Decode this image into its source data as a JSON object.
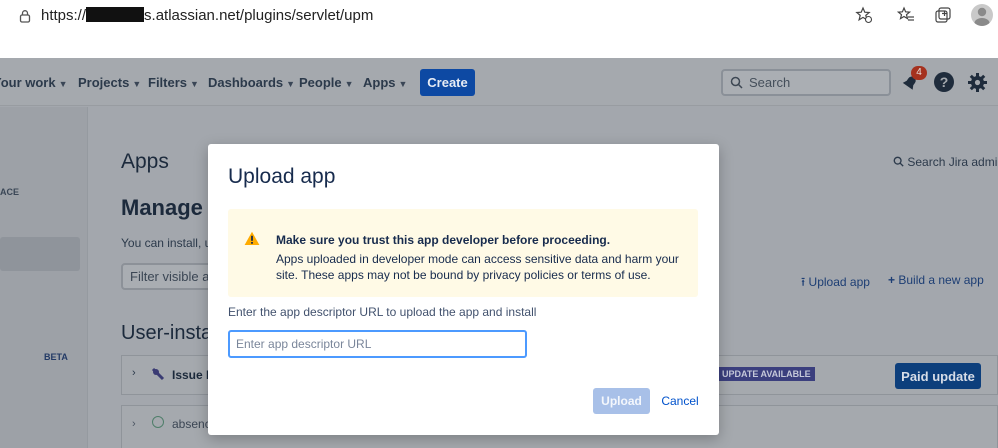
{
  "browser": {
    "url_prefix": "https://",
    "url_suffix": "s.atlassian.net/plugins/servlet/upm"
  },
  "nav": {
    "items": [
      {
        "label": "Your work"
      },
      {
        "label": "Projects"
      },
      {
        "label": "Filters"
      },
      {
        "label": "Dashboards"
      },
      {
        "label": "People"
      },
      {
        "label": "Apps"
      }
    ],
    "create_label": "Create",
    "search_placeholder": "Search",
    "notification_count": "4",
    "help_glyph": "?"
  },
  "sidebar": {
    "section_label": "ACE",
    "beta_label": "BETA"
  },
  "content": {
    "title": "Apps",
    "heading": "Manage a",
    "description": "You can install, u",
    "filter_placeholder": "Filter visible a",
    "user_installed": "User-instal",
    "search_jira_admin": "Search Jira admin",
    "upload_app_link": "Upload app",
    "build_app_link": "Build a new app",
    "rows": [
      {
        "name": "Issue L",
        "lozenge": "UPDATE AVAILABLE",
        "action": "Paid update"
      },
      {
        "name": "absenc"
      }
    ]
  },
  "modal": {
    "title": "Upload app",
    "warning_title": "Make sure you trust this app developer before proceeding.",
    "warning_body": "Apps uploaded in developer mode can access sensitive data and harm your site. These apps may not be bound by privacy policies or terms of use.",
    "field_label": "Enter the app descriptor URL to upload the app and install",
    "input_placeholder": "Enter app descriptor URL",
    "input_value": "",
    "upload_label": "Upload",
    "cancel_label": "Cancel"
  },
  "colors": {
    "primary": "#0052cc",
    "warning_bg": "#fffae6",
    "warning_icon": "#ffab00"
  }
}
